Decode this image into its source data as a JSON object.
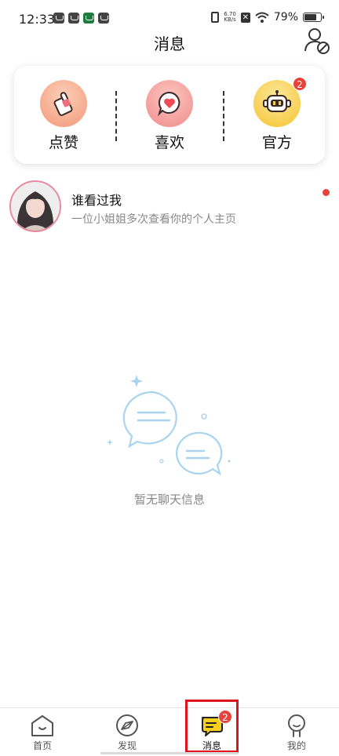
{
  "status_bar": {
    "time": "12:33",
    "net_speed_value": "6.70",
    "net_speed_unit": "KB/s",
    "battery_percent": "79%",
    "battery_level": 0.79
  },
  "header": {
    "title": "消息"
  },
  "quick_actions": [
    {
      "label": "点赞",
      "icon": "thumbs-up-icon",
      "color": "#f5a88f"
    },
    {
      "label": "喜欢",
      "icon": "heart-bubble-icon",
      "color": "#f49a9a"
    },
    {
      "label": "官方",
      "icon": "robot-icon",
      "color": "#f7d24e",
      "badge": "2"
    }
  ],
  "viewer": {
    "title": "谁看过我",
    "subtitle": "一位小姐姐多次查看你的个人主页"
  },
  "empty_state": {
    "text": "暂无聊天信息"
  },
  "bottom_nav": [
    {
      "label": "首页",
      "icon": "home-icon"
    },
    {
      "label": "发现",
      "icon": "compass-icon"
    },
    {
      "label": "消息",
      "icon": "message-icon",
      "badge": "2",
      "active": true
    },
    {
      "label": "我的",
      "icon": "profile-icon"
    }
  ],
  "colors": {
    "accent_red": "#e8423a",
    "highlight_frame": "#e0141e",
    "message_yellow": "#f7d01e",
    "bubble_blue": "#a9d4ef"
  }
}
